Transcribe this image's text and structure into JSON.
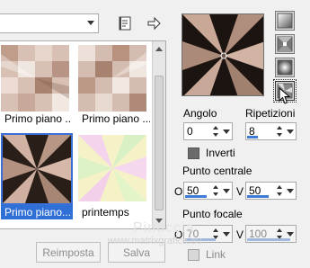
{
  "gallery": {
    "items": [
      {
        "caption": "Primo piano ..."
      },
      {
        "caption": "Primo piano ..."
      },
      {
        "caption": "Primo piano..."
      },
      {
        "caption": "printemps"
      }
    ]
  },
  "buttons": {
    "reset": "Reimposta",
    "save": "Salva"
  },
  "settings": {
    "angle_label": "Angolo",
    "angle_value": "0",
    "repeats_label": "Ripetizioni",
    "repeats_value": "8",
    "invert_label": "Inverti",
    "invert_checked": true,
    "center_label": "Punto centrale",
    "center_h_label": "O",
    "center_h_value": "50",
    "center_v_label": "V",
    "center_v_value": "50",
    "focal_label": "Punto focale",
    "focal_h_label": "O",
    "focal_h_value": "70",
    "focal_v_label": "V",
    "focal_v_value": "100",
    "link_label": "Link",
    "link_checked": false
  },
  "watermark": {
    "name": "Pinuccia",
    "site": "www.matrixgrafica.eu"
  },
  "icons": [
    "save-preset-icon",
    "forward-arrow-icon",
    "linear-gradient-icon",
    "rectangular-gradient-icon",
    "radial-gradient-icon",
    "sunburst-gradient-icon",
    "mouse-cursor-icon"
  ],
  "colors": {
    "selection": "#2f6fd6",
    "gradient_dark": "#1c1410",
    "gradient_light": "#c8a898"
  }
}
